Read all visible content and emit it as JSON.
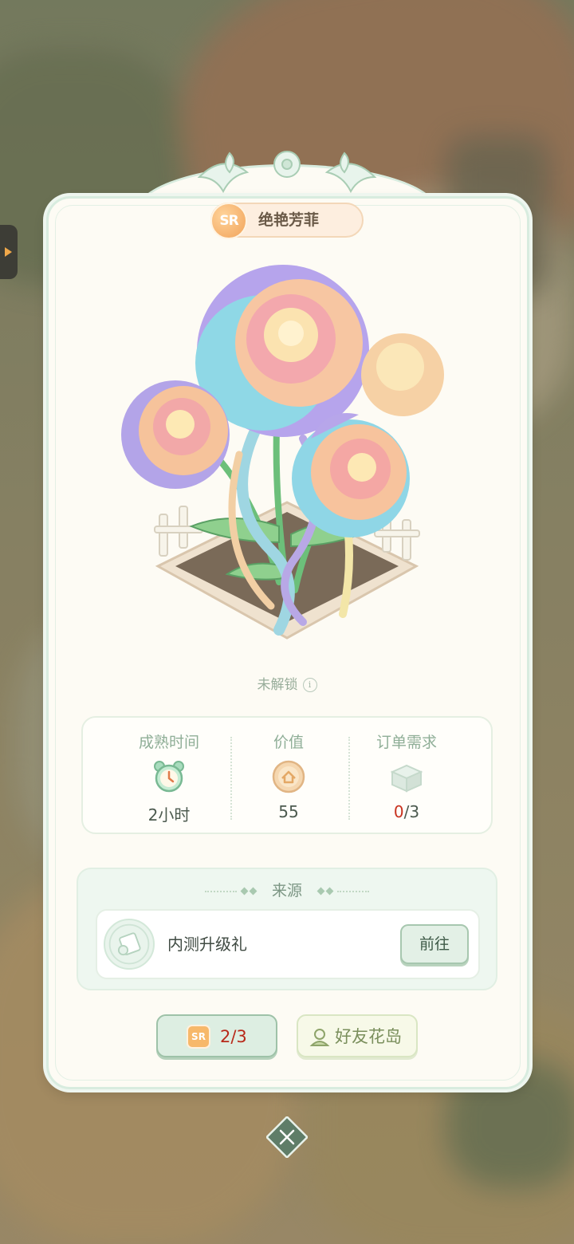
{
  "item": {
    "rarity": "SR",
    "name": "绝艳芳菲",
    "lock_status": "未解锁"
  },
  "stats": {
    "mature_time": {
      "label": "成熟时间",
      "value": "2小时"
    },
    "value": {
      "label": "价值",
      "value": "55"
    },
    "order_demand": {
      "label": "订单需求",
      "current": "0",
      "total": "/3"
    }
  },
  "source": {
    "title": "来源",
    "items": [
      {
        "label": "内测升级礼",
        "button": "前往"
      }
    ]
  },
  "footer": {
    "count_badge": "SR",
    "count": "2/3",
    "friend_island": "好友花岛"
  }
}
